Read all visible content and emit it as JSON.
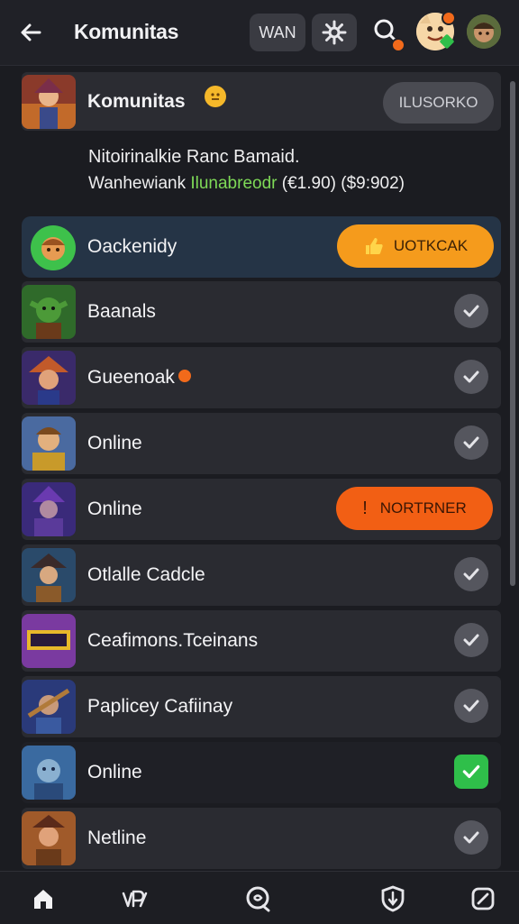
{
  "header": {
    "title": "Komunitas",
    "pill_left_label": "WAN",
    "icons": [
      "back-arrow-icon",
      "settings-gear-icon",
      "search-icon",
      "profile-avatar",
      "user-avatar"
    ]
  },
  "community_card": {
    "name": "Komunitas",
    "action_label": "ILUSORKO",
    "description_line1": "Nitoirinalkie Ranc Bamaid.",
    "description_line2_a": "Wanhewiank ",
    "description_line2_highlight": "Ilunabreodr",
    "description_line2_b": " (€1.90) ($9:902)"
  },
  "featured": {
    "name": "Oackenidy",
    "button_label": "UOTKCAK"
  },
  "items": [
    {
      "label": "Baanals",
      "status": "check"
    },
    {
      "label": "Gueenoak",
      "status": "check",
      "warning": true
    },
    {
      "label": "Online",
      "status": "check"
    },
    {
      "label": "Online",
      "status": "button",
      "button_label": "NORTRNER"
    },
    {
      "label": "Otlalle Cadcle",
      "status": "check"
    },
    {
      "label": "Ceafimons.Tceinans",
      "status": "check"
    },
    {
      "label": "Paplicey Cafiinay",
      "status": "check"
    },
    {
      "label": "Online",
      "status": "checked"
    },
    {
      "label": "Netline",
      "status": "check"
    }
  ],
  "colors": {
    "background": "#1b1c21",
    "card": "#2a2b31",
    "card_blue": "#273446",
    "accent_orange": "#f59b1c",
    "accent_red_orange": "#f25f14",
    "check_green": "#2fbf4a"
  },
  "bottom_nav": [
    "home-icon",
    "voice-icon",
    "chat-icon",
    "shield-icon",
    "edit-icon"
  ]
}
